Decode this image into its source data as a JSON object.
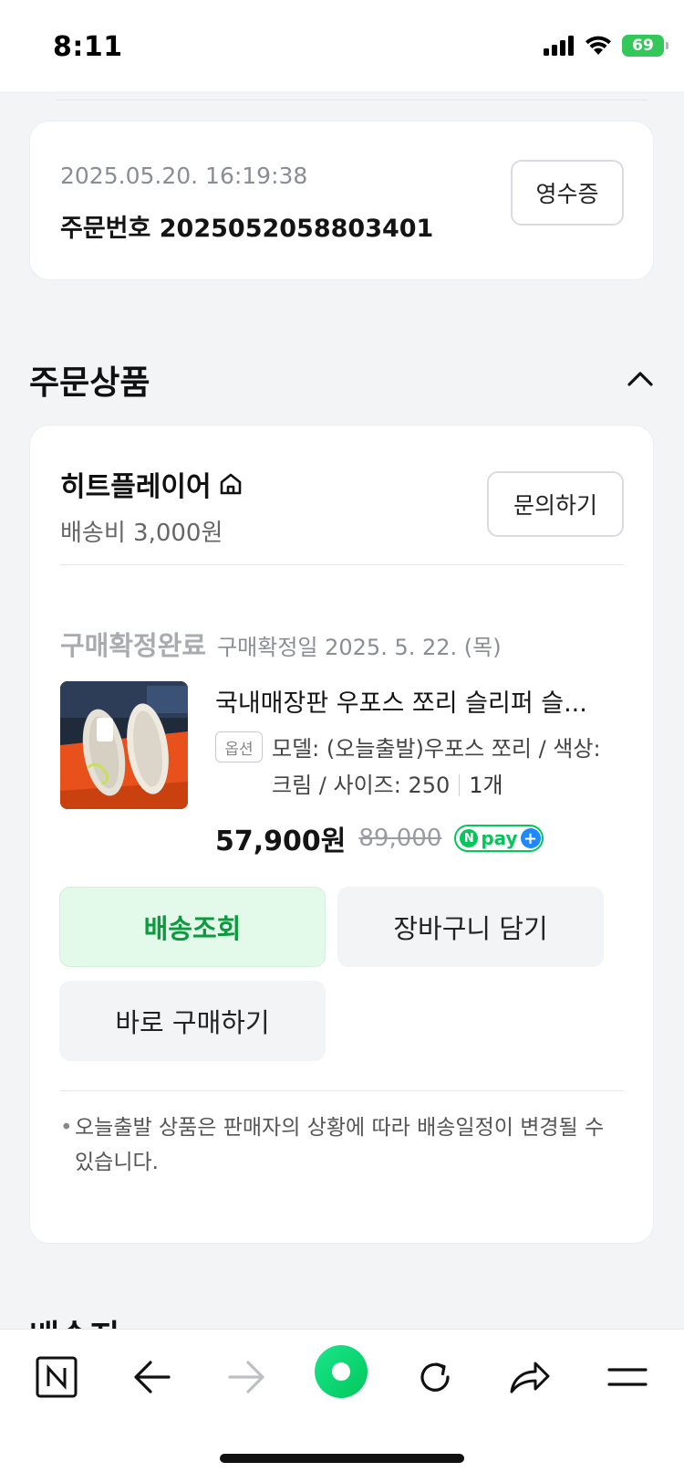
{
  "status_bar": {
    "time": "8:11",
    "battery": "69"
  },
  "order": {
    "datetime": "2025.05.20. 16:19:38",
    "order_number_label": "주문번호 2025052058803401",
    "receipt_button": "영수증"
  },
  "items_section": {
    "title": "주문상품",
    "shop": {
      "name": "히트플레이어",
      "shipping_fee": "배송비 3,000원",
      "inquiry_button": "문의하기"
    },
    "product": {
      "status": "구매확정완료",
      "confirm_date": "구매확정일 2025. 5. 22. (목)",
      "title": "국내매장판 우포스 쪼리 슬리퍼 슬...",
      "option_badge": "옵션",
      "option_text": "모델: (오늘출발)우포스 쪼리 / 색상: 크림 / 사이즈: 250",
      "quantity": "1개",
      "price": "57,900원",
      "original_price": "89,000",
      "npay_label": "pay"
    },
    "actions": {
      "track": "배송조회",
      "cart": "장바구니 담기",
      "buy_now": "바로 구매하기"
    },
    "notice": "오늘출발 상품은 판매자의 상황에 따라 배송일정이 변경될 수 있습니다.",
    "next_section_peek": "배송지"
  },
  "bottom_nav": {
    "icons": [
      "naver-n-icon",
      "back-arrow-icon",
      "forward-arrow-icon",
      "green-dot-home-icon",
      "refresh-icon",
      "share-icon",
      "menu-icon"
    ]
  },
  "colors": {
    "accent_green": "#03c75a",
    "track_button_bg": "#e3f9e9",
    "track_button_text": "#0c9a3e",
    "page_bg": "#f3f4f6"
  }
}
